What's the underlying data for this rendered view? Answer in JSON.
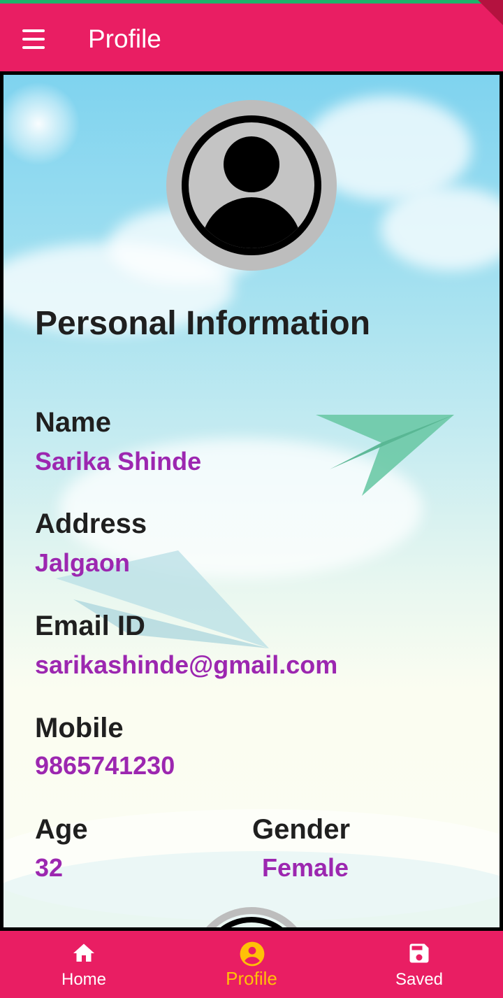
{
  "appbar": {
    "title": "Profile",
    "menu_icon": "hamburger-menu-icon"
  },
  "profile": {
    "avatar_icon": "account-circle-icon",
    "heading": "Personal Information",
    "fields": [
      {
        "label": "Name",
        "value": "Sarika Shinde"
      },
      {
        "label": "Address",
        "value": "Jalgaon"
      },
      {
        "label": "Email ID",
        "value": "sarikashinde@gmail.com"
      },
      {
        "label": "Mobile",
        "value": "9865741230"
      }
    ],
    "age": {
      "label": "Age",
      "value": "32"
    },
    "gender": {
      "label": "Gender",
      "value": "Female"
    }
  },
  "nav": {
    "items": [
      {
        "label": "Home",
        "icon": "home-icon",
        "active": false
      },
      {
        "label": "Profile",
        "icon": "account-circle-icon",
        "active": true
      },
      {
        "label": "Saved",
        "icon": "save-icon",
        "active": false
      }
    ],
    "colors": {
      "active": "#ffc107",
      "inactive": "#ffffff",
      "bar": "#e91e63"
    }
  },
  "theme": {
    "accent": "#e91e63",
    "value_color": "#9c27b0",
    "label_color": "#1f1f1f"
  }
}
